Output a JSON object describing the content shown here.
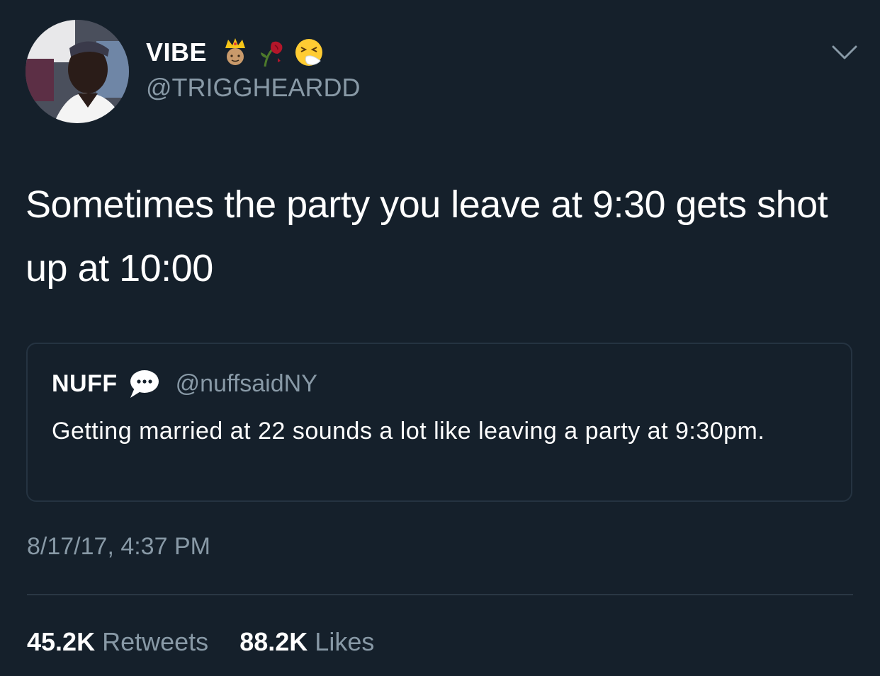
{
  "author": {
    "display_name": "VIBE",
    "handle": "@TRIGGHEARDD",
    "name_emojis": [
      "prince-emoji",
      "wilted-rose-emoji",
      "sneezing-face-emoji"
    ]
  },
  "tweet": {
    "text": "Sometimes the party you leave at 9:30 gets shot up at 10:00"
  },
  "quoted_tweet": {
    "display_name": "NUFF",
    "badge_icon": "speech-bubble-emoji",
    "handle": "@nuffsaidNY",
    "text": "Getting married at 22 sounds a lot like leaving a party at 9:30pm."
  },
  "meta": {
    "timestamp": "8/17/17, 4:37 PM"
  },
  "stats": {
    "retweets_count": "45.2K",
    "retweets_label": "Retweets",
    "likes_count": "88.2K",
    "likes_label": "Likes"
  },
  "colors": {
    "background": "#15202b",
    "text_primary": "#ffffff",
    "text_secondary": "#8899a6",
    "border": "#253341"
  }
}
